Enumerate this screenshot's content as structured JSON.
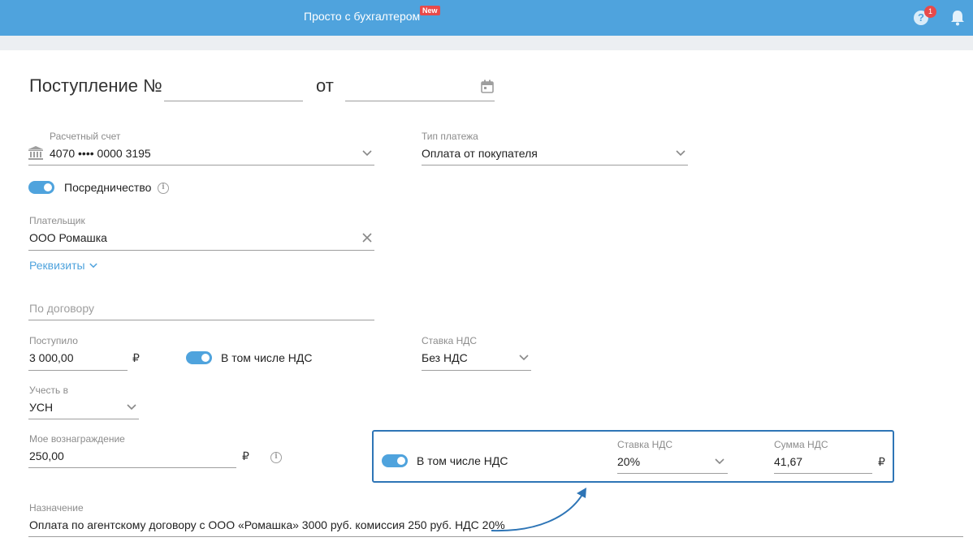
{
  "header": {
    "link_label": "Просто с бухгалтером",
    "new_badge": "New",
    "help_count": "1",
    "help_icon": "?",
    "accent_color": "#4fa3dd"
  },
  "form": {
    "title": "Поступление №",
    "from_label": "от",
    "account": {
      "label": "Расчетный счет",
      "value": "4070 •••• 0000 3195"
    },
    "payment_type": {
      "label": "Тип платежа",
      "value": "Оплата от покупателя"
    },
    "mediation": {
      "label": "Посредничество",
      "on": true
    },
    "payer": {
      "label": "Плательщик",
      "value": "ООО Ромашка"
    },
    "requisites_link": "Реквизиты",
    "contract": {
      "placeholder": "По договору"
    },
    "received": {
      "label": "Поступило",
      "value": "3 000,00",
      "currency": "₽"
    },
    "vat_included": {
      "label": "В том числе НДС",
      "on": true
    },
    "vat_rate": {
      "label": "Ставка НДС",
      "value": "Без НДС"
    },
    "account_in": {
      "label": "Учесть в",
      "value": "УСН"
    },
    "reward": {
      "label": "Мое вознаграждение",
      "value": "250,00",
      "currency": "₽"
    },
    "reward_vat": {
      "toggle_label": "В том числе НДС",
      "on": true,
      "rate_label": "Ставка НДС",
      "rate_value": "20%",
      "sum_label": "Сумма НДС",
      "sum_value": "41,67",
      "currency": "₽"
    },
    "purpose": {
      "label": "Назначение",
      "value": "Оплата по агентскому договору с ООО «Ромашка» 3000 руб. комиссия 250 руб. НДС 20%"
    }
  }
}
